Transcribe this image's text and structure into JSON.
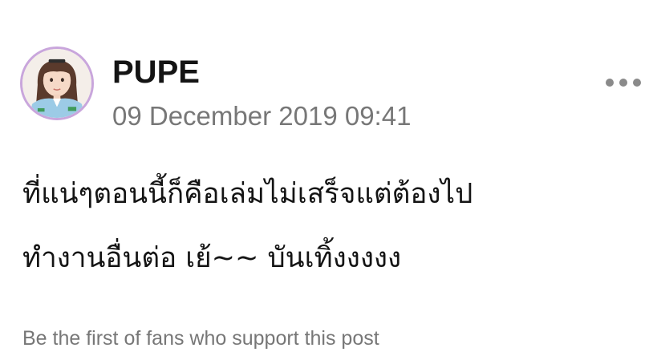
{
  "post": {
    "author": "PUPE",
    "timestamp": "09 December 2019 09:41",
    "body_lines": [
      "ที่แน่ๆตอนนี้ก็คือเล่มไม่เสร็จแต่ต้องไป",
      "ทำงานอื่นต่อ เย้~~ บันเทิ้งงงงง"
    ],
    "support_text": "Be the first of fans who support this post"
  },
  "icons": {
    "avatar": "profile-photo",
    "more": "more-horizontal-dots-icon"
  },
  "colors": {
    "avatar_ring": "#c9a6dc",
    "name": "#141414",
    "meta_text": "#777777",
    "dots": "#8a8a8a"
  }
}
